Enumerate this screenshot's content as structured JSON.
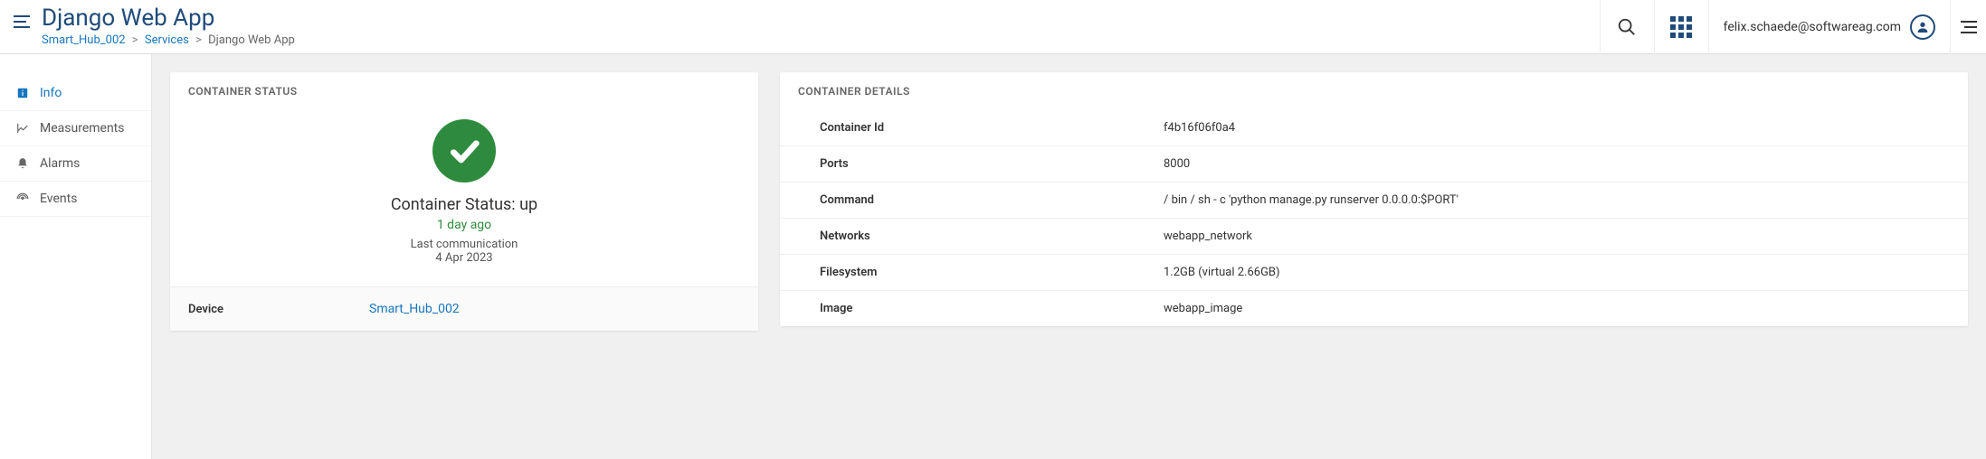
{
  "header": {
    "title": "Django Web App",
    "breadcrumb": {
      "hub": "Smart_Hub_002",
      "services": "Services",
      "current": "Django Web App"
    },
    "user_email": "felix.schaede@softwareag.com"
  },
  "sidebar": {
    "items": [
      {
        "label": "Info",
        "icon": "info-icon",
        "active": true
      },
      {
        "label": "Measurements",
        "icon": "chart-icon",
        "active": false
      },
      {
        "label": "Alarms",
        "icon": "bell-icon",
        "active": false
      },
      {
        "label": "Events",
        "icon": "signal-icon",
        "active": false
      }
    ]
  },
  "status_card": {
    "header": "CONTAINER STATUS",
    "status_text": "Container Status: up",
    "age": "1 day ago",
    "last_comm_label": "Last communication",
    "last_comm_date": "4 Apr 2023",
    "device_label": "Device",
    "device_link": "Smart_Hub_002"
  },
  "details_card": {
    "header": "CONTAINER DETAILS",
    "rows": [
      {
        "key": "Container Id",
        "val": "f4b16f06f0a4"
      },
      {
        "key": "Ports",
        "val": "8000"
      },
      {
        "key": "Command",
        "val": "/ bin / sh - c 'python manage.py runserver 0.0.0.0:$PORT'"
      },
      {
        "key": "Networks",
        "val": "webapp_network"
      },
      {
        "key": "Filesystem",
        "val": "1.2GB (virtual 2.66GB)"
      },
      {
        "key": "Image",
        "val": "webapp_image"
      }
    ]
  }
}
